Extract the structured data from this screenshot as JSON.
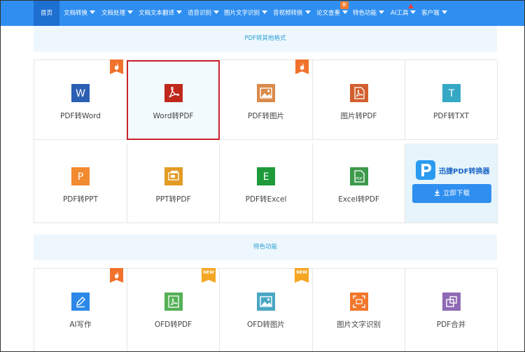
{
  "nav": {
    "items": [
      {
        "label": "首页"
      },
      {
        "label": "文档转换"
      },
      {
        "label": "文档处理"
      },
      {
        "label": "文档文本翻译"
      },
      {
        "label": "语音识别"
      },
      {
        "label": "图片文字识别"
      },
      {
        "label": "音视频转换"
      },
      {
        "label": "论文查重"
      },
      {
        "label": "特色功能"
      },
      {
        "label": "AI工具"
      },
      {
        "label": "客户端"
      }
    ],
    "new_badge": "新",
    "accent": "#2f8ff0"
  },
  "section1": {
    "title": "PDF转其他格式"
  },
  "section2": {
    "title": "特色功能"
  },
  "tools_row1": [
    {
      "label": "PDF转Word",
      "icon": "word-icon",
      "tag": "hot"
    },
    {
      "label": "Word转PDF",
      "icon": "pdf-icon",
      "tag": ""
    },
    {
      "label": "PDF转图片",
      "icon": "image-icon",
      "tag": "hot"
    },
    {
      "label": "图片转PDF",
      "icon": "pdf-doc-icon",
      "tag": ""
    },
    {
      "label": "PDF转TXT",
      "icon": "txt-icon",
      "tag": ""
    }
  ],
  "tools_row2": [
    {
      "label": "PDF转PPT",
      "icon": "ppt-icon",
      "tag": ""
    },
    {
      "label": "PPT转PDF",
      "icon": "ppt-pdf-icon",
      "tag": ""
    },
    {
      "label": "PDF转Excel",
      "icon": "excel-icon",
      "tag": ""
    },
    {
      "label": "Excel转PDF",
      "icon": "excel-pdf-icon",
      "tag": ""
    }
  ],
  "promo": {
    "title": "迅捷PDF转换器",
    "button": "立即下载",
    "logo_text": "P"
  },
  "tools_row3": [
    {
      "label": "AI写作",
      "icon": "pen-icon",
      "tag": "hot"
    },
    {
      "label": "OFD转PDF",
      "icon": "ofd-pdf-icon",
      "tag": "new"
    },
    {
      "label": "OFD转图片",
      "icon": "ofd-image-icon",
      "tag": "new"
    },
    {
      "label": "图片文字识别",
      "icon": "ocr-icon",
      "tag": ""
    },
    {
      "label": "PDF合并",
      "icon": "merge-icon",
      "tag": ""
    }
  ],
  "icon_letters": {
    "word": "W",
    "txt": "T",
    "ppt": "P",
    "excel": "E",
    "pdf_small": "PDF"
  },
  "tag_new_text": "NEW",
  "colors": {
    "word": "#2b5fb4",
    "pdf": "#c0281c",
    "image": "#d98a4a",
    "pdf_doc": "#d2602f",
    "txt": "#35a8c6",
    "ppt": "#f28a30",
    "ppt_pdf": "#e29b24",
    "excel": "#1e9a3a",
    "excel_pdf": "#3d9a4b",
    "pen": "#2b88e6",
    "ofd_pdf": "#55b056",
    "ofd_image": "#4aa7c4",
    "ocr": "#f2772b",
    "merge": "#8e69b5",
    "selected_border": "#c8232c",
    "hot": "#f0722c",
    "new": "#f5a623"
  }
}
